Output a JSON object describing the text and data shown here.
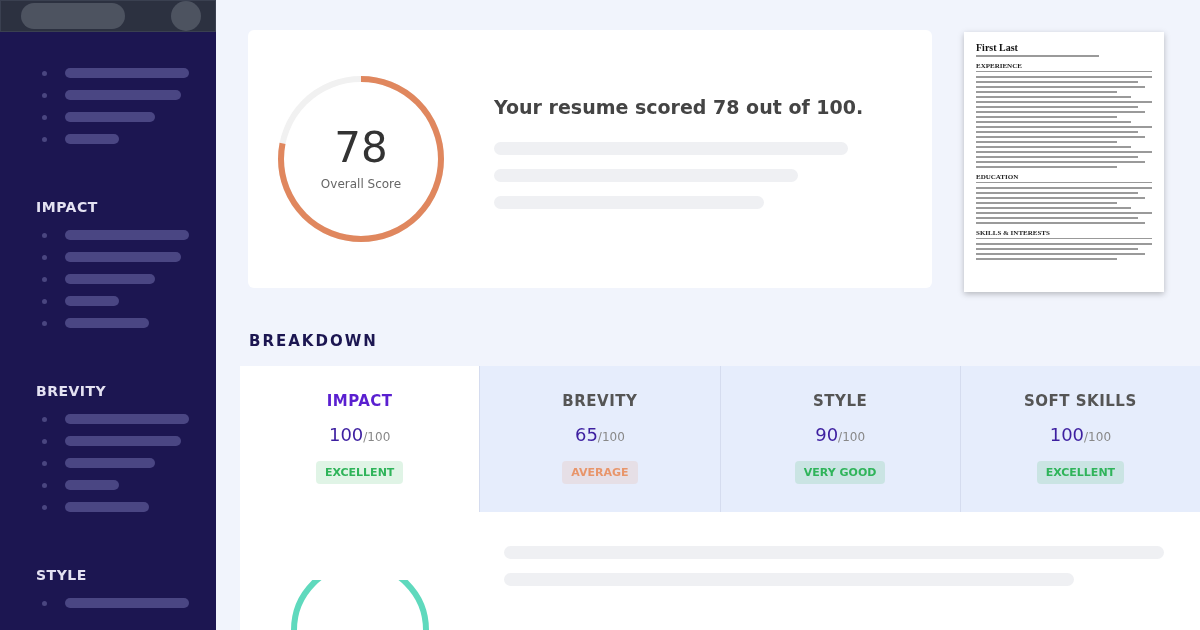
{
  "sidebar": {
    "sections": [
      {
        "title": "IMPACT"
      },
      {
        "title": "BREVITY"
      },
      {
        "title": "STYLE"
      }
    ]
  },
  "score_card": {
    "score": "78",
    "score_label": "Overall Score",
    "level": 0.78,
    "headline": "Your resume scored 78 out of 100."
  },
  "resume_preview": {
    "name": "First Last",
    "headings": [
      "EXPERIENCE",
      "EDUCATION",
      "SKILLS & INTERESTS"
    ]
  },
  "breakdown": {
    "title": "BREAKDOWN",
    "categories": [
      {
        "name": "IMPACT",
        "score": "100",
        "max": "/100",
        "rating": "EXCELLENT",
        "color": "#2fb45a",
        "selected": true
      },
      {
        "name": "BREVITY",
        "score": "65",
        "max": "/100",
        "rating": "AVERAGE",
        "color": "#e8956a",
        "selected": false
      },
      {
        "name": "STYLE",
        "score": "90",
        "max": "/100",
        "rating": "VERY GOOD",
        "color": "#2fb45a",
        "selected": false
      },
      {
        "name": "SOFT SKILLS",
        "score": "100",
        "max": "/100",
        "rating": "EXCELLENT",
        "color": "#2fb45a",
        "selected": false
      }
    ]
  }
}
